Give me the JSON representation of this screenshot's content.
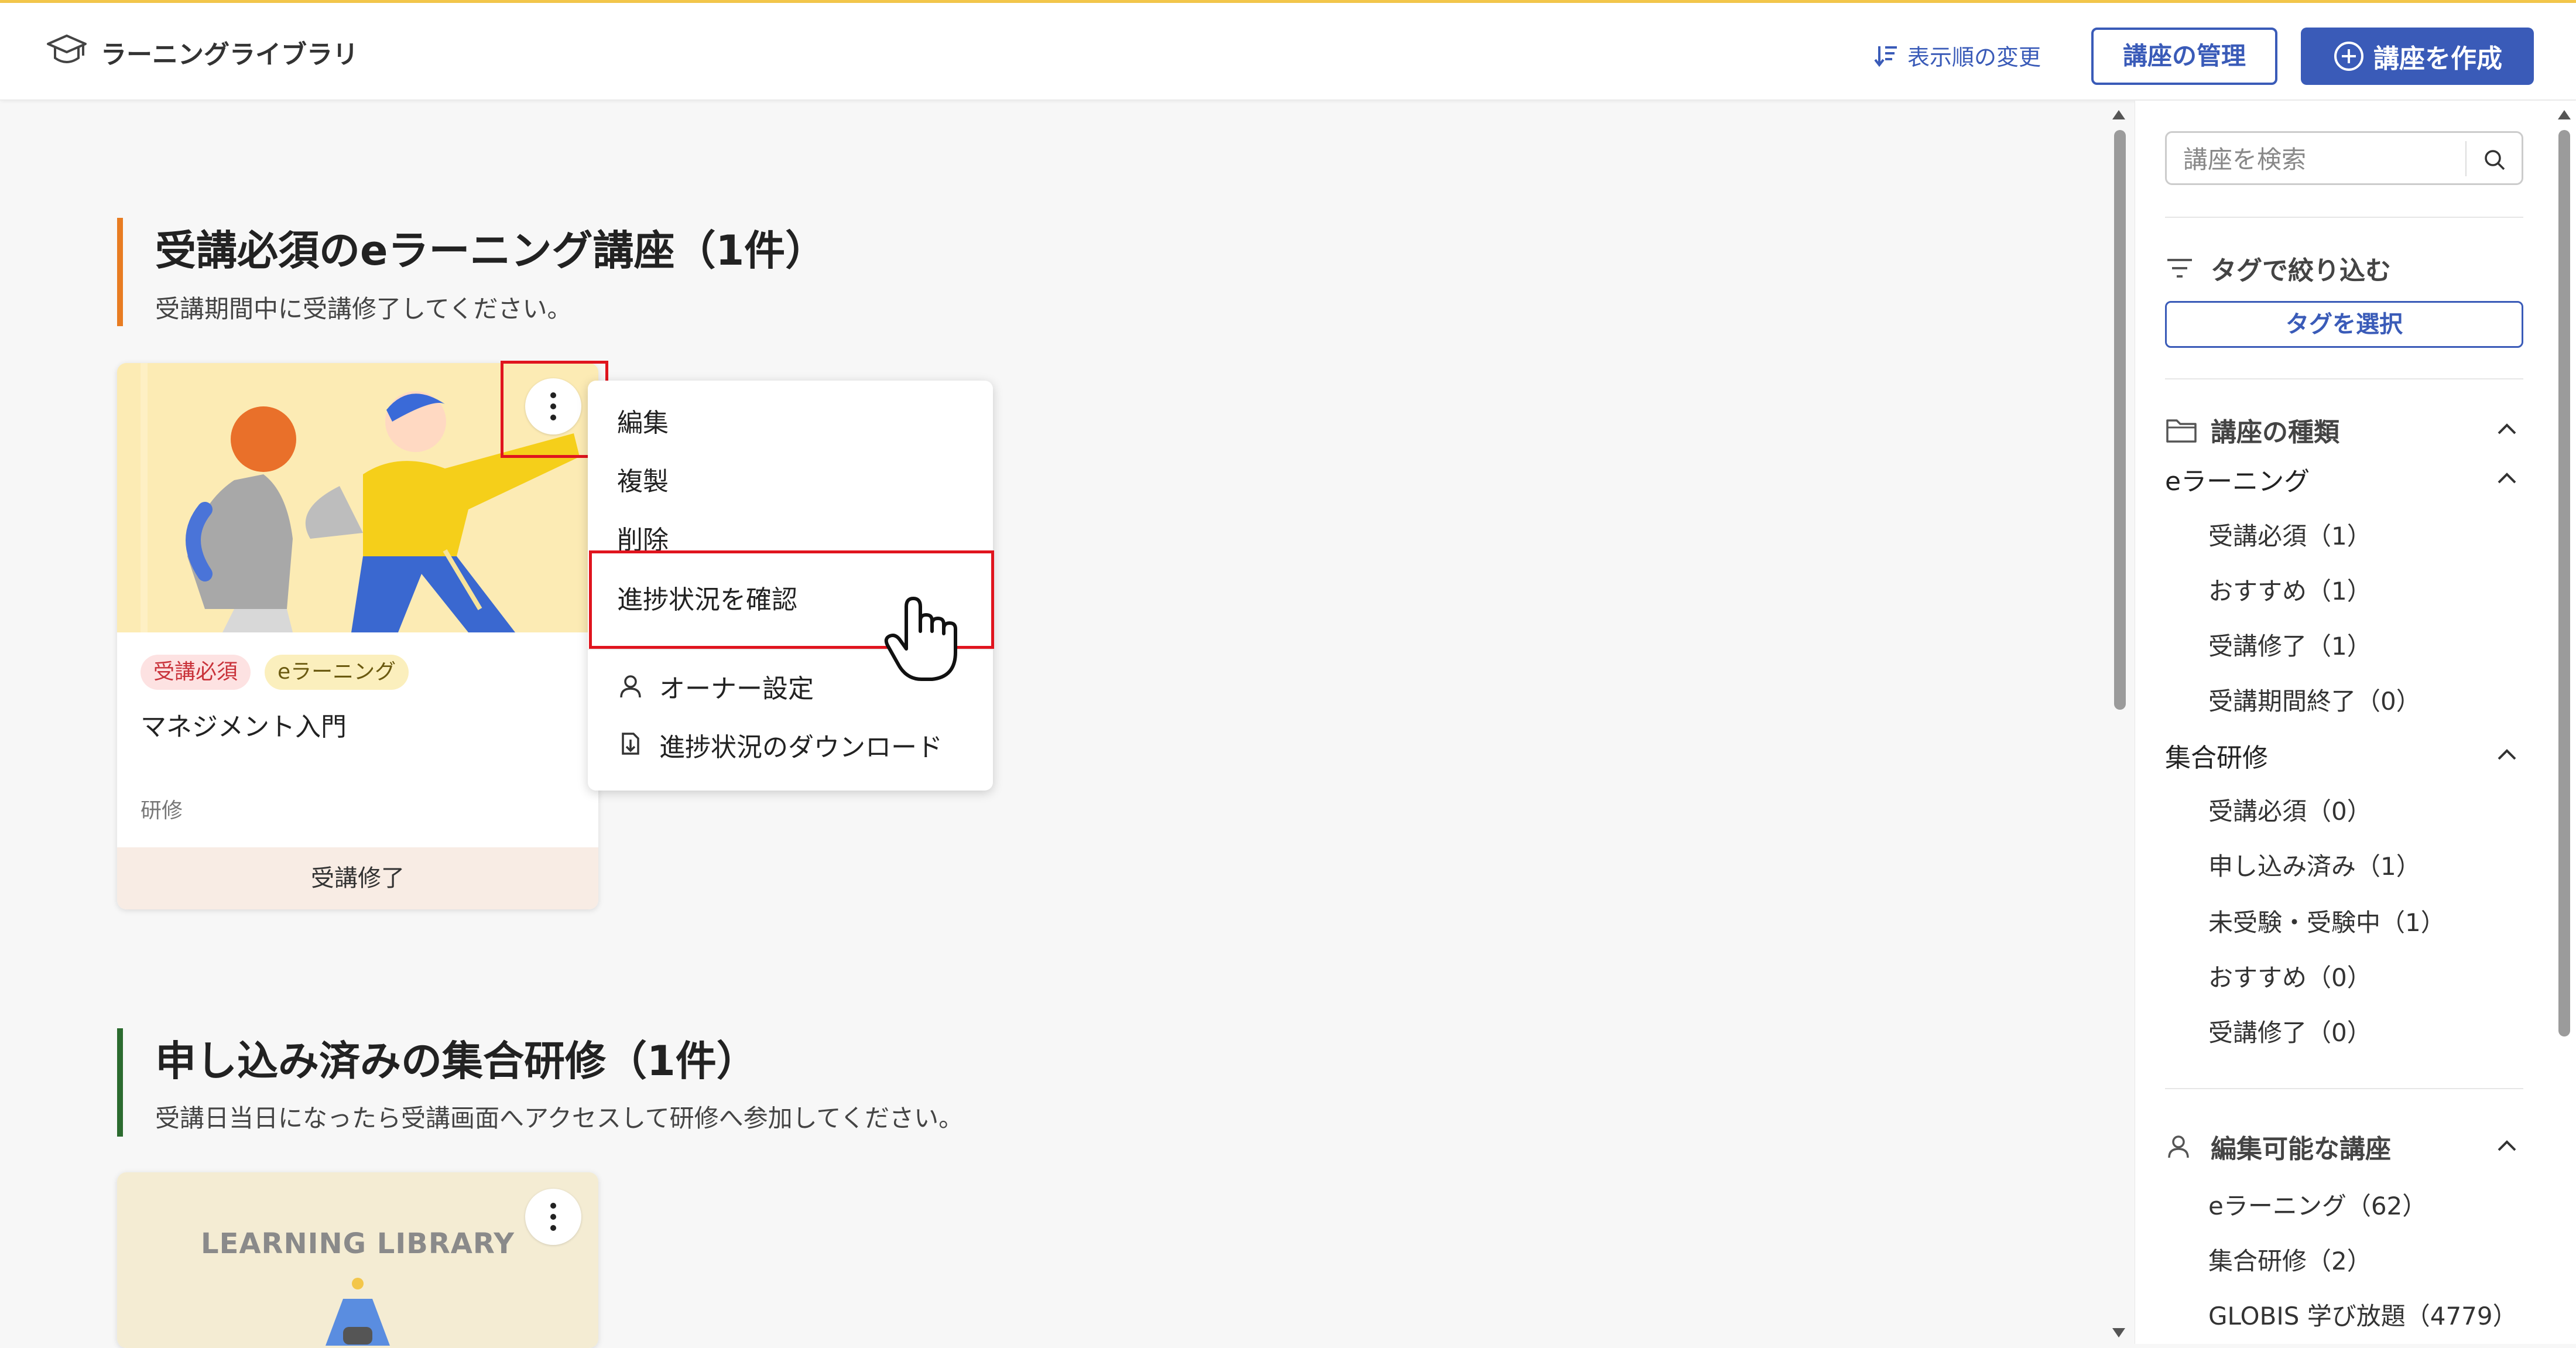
{
  "header": {
    "title": "ラーニングライブラリ",
    "sort_label": "表示順の変更",
    "manage_label": "講座の管理",
    "create_label": "講座を作成"
  },
  "sections": [
    {
      "title": "受講必須のeラーニング講座（1件）",
      "subtitle": "受講期間中に受講修了してください。",
      "accent": "#e87c22",
      "card": {
        "tags": [
          "受講必須",
          "eラーニング"
        ],
        "title": "マネジメント入門",
        "category": "研修",
        "status": "受講修了"
      }
    },
    {
      "title": "申し込み済みの集合研修（1件）",
      "subtitle": "受講日当日になったら受講画面へアクセスして研修へ参加してください。",
      "accent": "#2b6b2f",
      "card": {
        "image_text": "LEARNING LIBRARY"
      }
    }
  ],
  "context_menu": {
    "items": [
      {
        "label": "編集"
      },
      {
        "label": "複製"
      },
      {
        "label": "削除"
      },
      {
        "label": "進捗状況を確認",
        "highlighted": true
      },
      {
        "label": "オーナー設定",
        "icon": "person-icon"
      },
      {
        "label": "進捗状況のダウンロード",
        "icon": "download-icon"
      }
    ]
  },
  "sidebar": {
    "search_placeholder": "講座を検索",
    "tag_filter_label": "タグで絞り込む",
    "tag_select_label": "タグを選択",
    "course_type_label": "講座の種類",
    "elearning": {
      "label": "eラーニング",
      "items": [
        "受講必須（1）",
        "おすすめ（1）",
        "受講修了（1）",
        "受講期間終了（0）"
      ]
    },
    "group_training": {
      "label": "集合研修",
      "items": [
        "受講必須（0）",
        "申し込み済み（1）",
        "未受験・受験中（1）",
        "おすすめ（0）",
        "受講修了（0）"
      ]
    },
    "editable": {
      "label": "編集可能な講座",
      "items": [
        "eラーニング（62）",
        "集合研修（2）",
        "GLOBIS 学び放題（4779）"
      ]
    }
  },
  "colors": {
    "accent_blue": "#3a5bb8",
    "highlight_red": "#e0141e",
    "required_tag_bg": "#fde2e2",
    "elearning_tag_bg": "#fbefbd"
  }
}
